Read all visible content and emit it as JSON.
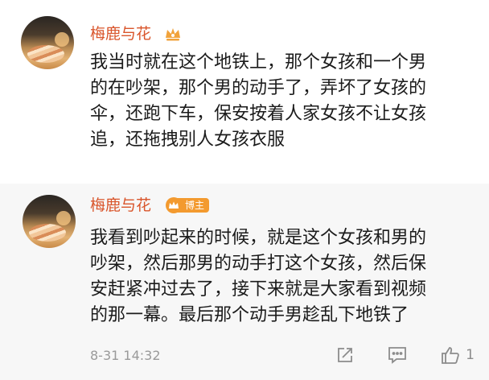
{
  "comments": [
    {
      "author": "梅鹿与花",
      "lines": [
        "我当时就在这个地铁上，那个女孩和一个男",
        "的在吵架，那个男的动手了，弄坏了女孩的",
        "伞，还跑下车，保安按着人家女孩不让女孩",
        "追，还拖拽别人女孩衣服"
      ]
    },
    {
      "author": "梅鹿与花",
      "badge": "博主",
      "lines": [
        "我看到吵起来的时候，就是这个女孩和男的",
        "吵架，然后那男的动手打这个女孩，然后保",
        "安赶紧冲过去了，接下来就是大家看到视频",
        "的那一幕。最后那个动手男趁乱下地铁了"
      ],
      "time": "8-31 14:32",
      "like_count": "1"
    }
  ],
  "icons": {
    "badge": "crown-icon",
    "share": "share-icon",
    "comment": "comment-icon",
    "like": "thumbs-up-icon"
  },
  "colors": {
    "name": "#d9552b",
    "badge": "#f39a2f",
    "reply_bg": "#f7f7f7",
    "text": "#1b1b1b",
    "meta": "#9a9a9a"
  }
}
